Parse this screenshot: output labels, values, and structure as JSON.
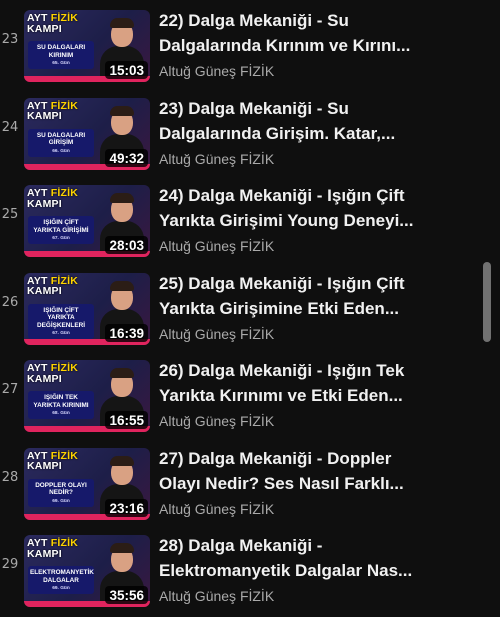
{
  "playlist": {
    "items": [
      {
        "index": "23",
        "title_line1": "22) Dalga Mekaniği - Su",
        "title_line2": "Dalgalarında Kırınım ve Kırını...",
        "channel": "Altuğ Güneş FİZİK",
        "duration": "15:03",
        "thumb_topic": "SU DALGALARI KIRINIM",
        "thumb_day": "65. Gün"
      },
      {
        "index": "24",
        "title_line1": "23) Dalga Mekaniği - Su",
        "title_line2": "Dalgalarında Girişim. Katar,...",
        "channel": "Altuğ Güneş FİZİK",
        "duration": "49:32",
        "thumb_topic": "SU DALGALARI GİRİŞİM",
        "thumb_day": "66. Gün"
      },
      {
        "index": "25",
        "title_line1": "24) Dalga Mekaniği - Işığın Çift",
        "title_line2": "Yarıkta Girişimi Young Deneyi...",
        "channel": "Altuğ Güneş FİZİK",
        "duration": "28:03",
        "thumb_topic": "IŞIĞIN ÇİFT YARIKTA GİRİŞİMİ",
        "thumb_day": "67. Gün"
      },
      {
        "index": "26",
        "title_line1": "25) Dalga Mekaniği - Işığın Çift",
        "title_line2": "Yarıkta Girişimine Etki Eden...",
        "channel": "Altuğ Güneş FİZİK",
        "duration": "16:39",
        "thumb_topic": "IŞIĞIN ÇİFT YARIKTA DEĞİŞKENLERİ",
        "thumb_day": "67. Gün"
      },
      {
        "index": "27",
        "title_line1": "26) Dalga Mekaniği - Işığın Tek",
        "title_line2": "Yarıkta Kırınımı ve Etki Eden...",
        "channel": "Altuğ Güneş FİZİK",
        "duration": "16:55",
        "thumb_topic": "IŞIĞIN TEK YARIKTA KIRINIMI",
        "thumb_day": "68. Gün"
      },
      {
        "index": "28",
        "title_line1": "27) Dalga Mekaniği - Doppler",
        "title_line2": "Olayı Nedir? Ses Nasıl Farklı...",
        "channel": "Altuğ Güneş FİZİK",
        "duration": "23:16",
        "thumb_topic": "DOPPLER OLAYI NEDİR?",
        "thumb_day": "69. Gün"
      },
      {
        "index": "29",
        "title_line1": "28) Dalga Mekaniği -",
        "title_line2": "Elektromanyetik Dalgalar Nas...",
        "channel": "Altuğ Güneş FİZİK",
        "duration": "35:56",
        "thumb_topic": "ELEKTROMANYETİK DALGALAR",
        "thumb_day": "69. Gün"
      }
    ],
    "thumb_badge": {
      "line1": "AYT",
      "line1b": "FİZİK",
      "line2": "KAMPI"
    },
    "top_partial_channel": "Altuğ Güneş FİZİK"
  },
  "colors": {
    "background": "#0f0f0f",
    "title_text": "#f1f1f1",
    "secondary_text": "#aaaaaa",
    "accent_pink": "#e0245e",
    "badge_yellow": "#ffd400",
    "topic_box": "#16196a"
  }
}
